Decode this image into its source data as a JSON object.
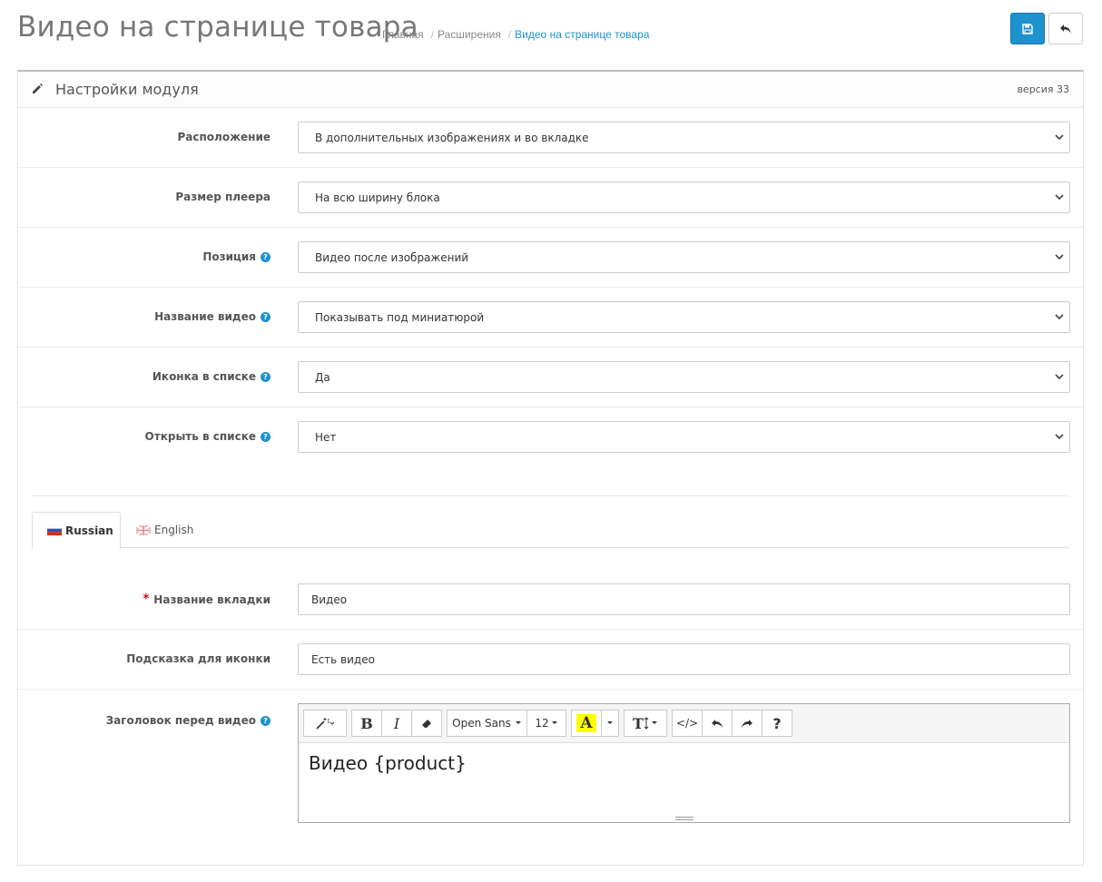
{
  "header": {
    "title": "Видео на странице товара",
    "breadcrumbs": [
      "Главная",
      "Расширения",
      "Видео на странице товара"
    ]
  },
  "colors": {
    "primary": "#1e91cf",
    "required": "#dd0000"
  },
  "icons": {
    "save": "save-icon",
    "back": "reply-icon",
    "heading": "pencil-icon",
    "help": "question-circle-icon",
    "chevron": "chevron-down-icon"
  },
  "panel": {
    "title": "Настройки модуля",
    "version": "версия 33"
  },
  "settings": [
    {
      "label": "Расположение",
      "value": "В дополнительных изображениях и во вкладке",
      "help": false
    },
    {
      "label": "Размер плеера",
      "value": "На всю ширину блока",
      "help": false
    },
    {
      "label": "Позиция",
      "value": "Видео после изображений",
      "help": true
    },
    {
      "label": "Название видео",
      "value": "Показывать под миниатюрой",
      "help": true
    },
    {
      "label": "Иконка в списке",
      "value": "Да",
      "help": true
    },
    {
      "label": "Открыть в списке",
      "value": "Нет",
      "help": true
    }
  ],
  "tabs": [
    {
      "label": "Russian",
      "active": true
    },
    {
      "label": "English",
      "active": false
    }
  ],
  "lang_fields": {
    "tab_name": {
      "label": "Название вкладки",
      "value": "Видео"
    },
    "icon_hint": {
      "label": "Подсказка для иконки",
      "value": "Есть видео"
    },
    "header_before": {
      "label": "Заголовок перед видео",
      "content": "Видео {product}"
    }
  },
  "editor_toolbar": {
    "bold": "B",
    "italic": "I",
    "font": "Open Sans",
    "size": "12",
    "color_letter": "A",
    "height_letter": "T",
    "code": "</>",
    "help": "?"
  }
}
